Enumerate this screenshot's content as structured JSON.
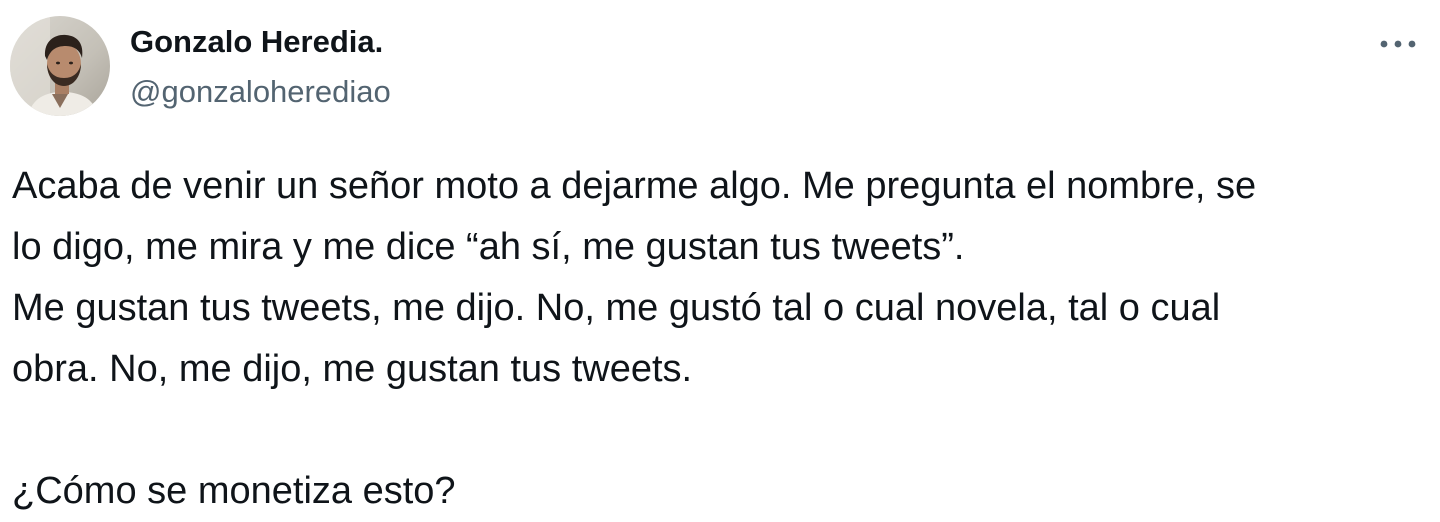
{
  "author": {
    "display_name": "Gonzalo Heredia.",
    "handle": "@gonzaloherediao",
    "avatar_icon": "profile-photo"
  },
  "menu": {
    "more_icon": "more-options-icon"
  },
  "tweet": {
    "lines": [
      "Acaba de venir un señor moto a dejarme algo. Me pregunta el nombre, se",
      "lo digo, me mira y me dice “ah sí, me gustan tus tweets”.",
      "Me gustan tus tweets, me dijo. No, me gustó tal o cual novela, tal o cual",
      "obra. No, me dijo, me gustan tus tweets.",
      "",
      "¿Cómo se monetiza esto?"
    ]
  },
  "colors": {
    "text": "#0f1419",
    "secondary_text": "#536471",
    "background": "#ffffff"
  }
}
